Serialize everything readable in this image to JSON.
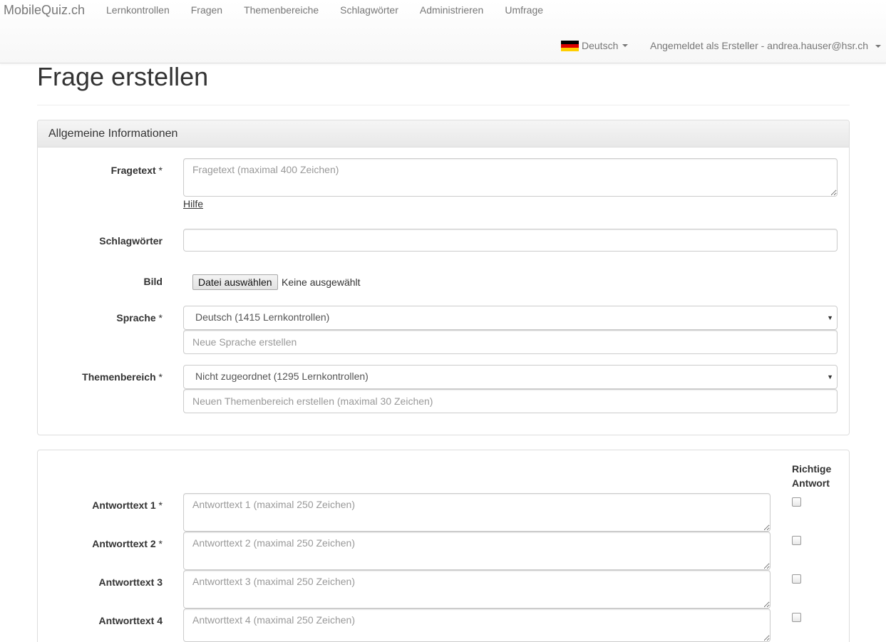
{
  "navbar": {
    "brand": "MobileQuiz.ch",
    "links": [
      "Lernkontrollen",
      "Fragen",
      "Themenbereiche",
      "Schlagwörter",
      "Administrieren",
      "Umfrage"
    ],
    "language": "Deutsch",
    "user": "Angemeldet als Ersteller - andrea.hauser@hsr.ch"
  },
  "page": {
    "title": "Frage erstellen"
  },
  "general": {
    "heading": "Allgemeine Informationen",
    "fragetext_label": "Fragetext",
    "fragetext_placeholder": "Fragetext (maximal 400 Zeichen)",
    "help_link": "Hilfe",
    "schlagwoerter_label": "Schlagwörter",
    "bild_label": "Bild",
    "file_button": "Datei auswählen",
    "file_status": "Keine ausgewählt",
    "sprache_label": "Sprache",
    "sprache_value": "Deutsch (1415 Lernkontrollen)",
    "new_language_placeholder": "Neue Sprache erstellen",
    "themenbereich_label": "Themenbereich",
    "themenbereich_value": "Nicht zugeordnet (1295 Lernkontrollen)",
    "new_topic_placeholder": "Neuen Themenbereich erstellen (maximal 30 Zeichen)",
    "required_marker": "*"
  },
  "answers": {
    "correct_header_line1": "Richtige",
    "correct_header_line2": "Antwort",
    "items": [
      {
        "label": "Antworttext 1",
        "required": "*",
        "placeholder": "Antworttext 1 (maximal 250 Zeichen)"
      },
      {
        "label": "Antworttext 2",
        "required": "*",
        "placeholder": "Antworttext 2 (maximal 250 Zeichen)"
      },
      {
        "label": "Antworttext 3",
        "required": "",
        "placeholder": "Antworttext 3 (maximal 250 Zeichen)"
      },
      {
        "label": "Antworttext 4",
        "required": "",
        "placeholder": "Antworttext 4 (maximal 250 Zeichen)"
      }
    ]
  },
  "colors": {
    "navbar_text": "#777777",
    "panel_border": "#dddddd",
    "flag_black": "#000000",
    "flag_red": "#dd0000",
    "flag_gold": "#ffce00"
  }
}
